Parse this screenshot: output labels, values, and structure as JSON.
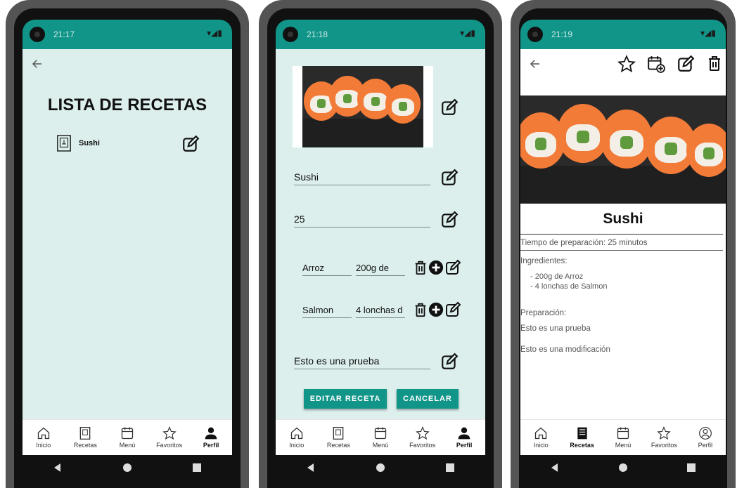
{
  "status": {
    "screen1_time": "21:17",
    "screen2_time": "21:18",
    "screen3_time": "21:19"
  },
  "screen1": {
    "title": "LISTA DE RECETAS",
    "recipes": [
      {
        "name": "Sushi"
      }
    ]
  },
  "screen2": {
    "name_value": "Sushi",
    "time_value": "25",
    "ingredients": [
      {
        "name": "Arroz",
        "quantity": "200g de"
      },
      {
        "name": "Salmon",
        "quantity": "4 lonchas d"
      }
    ],
    "preparation_value": "Esto es una prueba",
    "edit_button": "EDITAR RECETA",
    "cancel_button": "CANCELAR"
  },
  "screen3": {
    "title": "Sushi",
    "prep_time": "Tiempo de preparación: 25 minutos",
    "ingredients_label": "Ingredientes:",
    "ingredients": [
      "- 200g de Arroz",
      "- 4 lonchas de Salmon"
    ],
    "preparation_label": "Preparación:",
    "preparation_lines": [
      "Esto es una prueba",
      "Esto es una modificación"
    ]
  },
  "nav": {
    "inicio": "Inicio",
    "recetas": "Recetas",
    "menu": "Menú",
    "favoritos": "Favoritos",
    "perfil": "Perfil"
  },
  "colors": {
    "accent": "#109588",
    "mint": "#dcefed",
    "salmon": "#f37b38"
  }
}
